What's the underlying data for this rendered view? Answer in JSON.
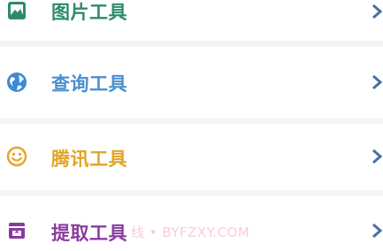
{
  "menu": {
    "items": [
      {
        "label": "图片工具",
        "icon": "image-icon",
        "color": "#2e8b6a"
      },
      {
        "label": "查询工具",
        "icon": "globe-icon",
        "color": "#4a8fd0"
      },
      {
        "label": "腾讯工具",
        "icon": "smile-icon",
        "color": "#e0a526"
      },
      {
        "label": "提取工具",
        "icon": "archive-icon",
        "color": "#8b3aa0"
      }
    ]
  },
  "watermark": {
    "text": "线 • BYFZXY.COM"
  }
}
